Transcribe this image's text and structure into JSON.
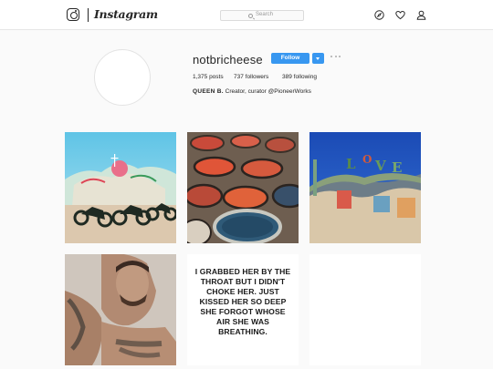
{
  "header": {
    "wordmark": "Instagram",
    "search_placeholder": "Search",
    "icons": [
      "instagram-glyph-icon",
      "compass-icon",
      "heart-icon",
      "person-icon"
    ]
  },
  "profile": {
    "username": "notbricheese",
    "follow_label": "Follow",
    "stats": {
      "posts": "1,375 posts",
      "followers": "737 followers",
      "following": "389 following"
    },
    "bio_name": "QUEEN B.",
    "bio_text": "Creator, curator @PioneerWorks"
  },
  "posts": [
    {
      "kind": "photo",
      "subject": "motorcycles in desert"
    },
    {
      "kind": "photo",
      "subject": "paint buckets"
    },
    {
      "kind": "photo",
      "subject": "LOVE sign arch"
    },
    {
      "kind": "photo",
      "subject": "tattooed man"
    },
    {
      "kind": "text",
      "text": "I GRABBED HER BY THE THROAT BUT I DIDN'T CHOKE HER. JUST KISSED HER SO DEEP SHE FORGOT WHOSE AIR SHE WAS BREATHING."
    },
    {
      "kind": "blank"
    }
  ],
  "colors": {
    "accent": "#3897f0",
    "background": "#fafafa",
    "text": "#262626"
  }
}
